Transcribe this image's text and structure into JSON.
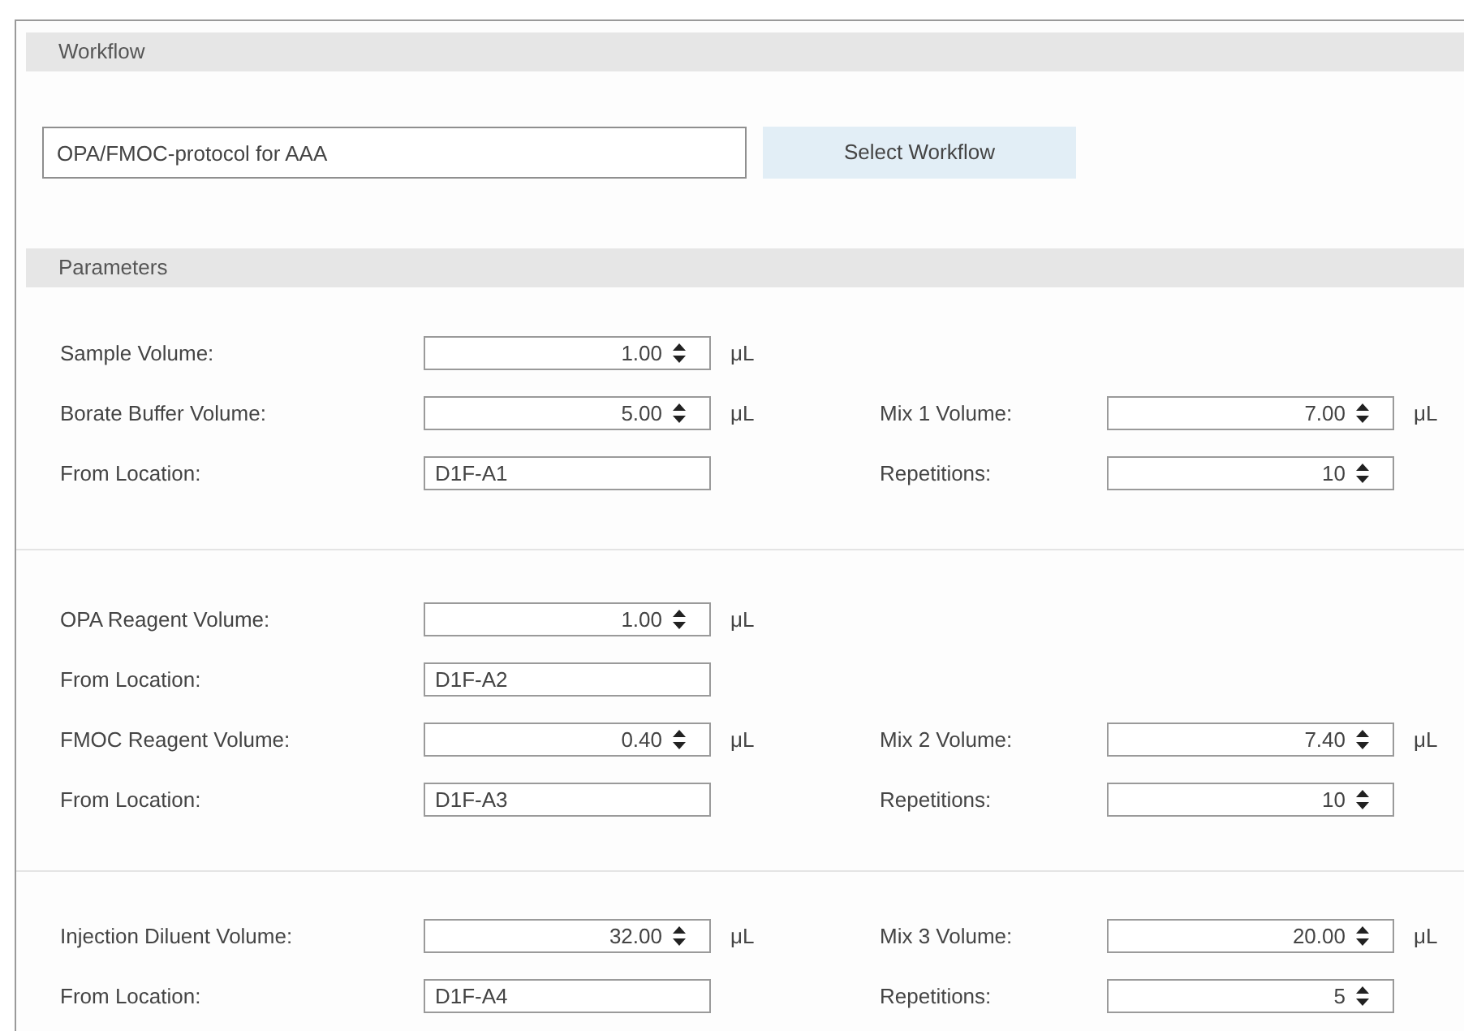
{
  "workflow": {
    "header": "Workflow",
    "field": {
      "value": "OPA/FMOC-protocol for AAA"
    },
    "button": "Select Workflow"
  },
  "parameters": {
    "header": "Parameters",
    "groups": [
      {
        "rows": [
          {
            "left": {
              "label": "Sample Volume:",
              "kind": "spin",
              "value": "1.00",
              "unit": "μL"
            }
          },
          {
            "left": {
              "label": "Borate Buffer Volume:",
              "kind": "spin",
              "value": "5.00",
              "unit": "μL"
            },
            "right": {
              "label": "Mix 1 Volume:",
              "kind": "spin",
              "value": "7.00",
              "unit": "μL"
            }
          },
          {
            "left": {
              "label": "From Location:",
              "kind": "text",
              "value": "D1F-A1"
            },
            "right": {
              "label": "Repetitions:",
              "kind": "spin",
              "value": "10"
            }
          }
        ]
      },
      {
        "rows": [
          {
            "left": {
              "label": "OPA Reagent Volume:",
              "kind": "spin",
              "value": "1.00",
              "unit": "μL"
            }
          },
          {
            "left": {
              "label": "From Location:",
              "kind": "text",
              "value": "D1F-A2"
            }
          },
          {
            "left": {
              "label": "FMOC Reagent Volume:",
              "kind": "spin",
              "value": "0.40",
              "unit": "μL"
            },
            "right": {
              "label": "Mix 2 Volume:",
              "kind": "spin",
              "value": "7.40",
              "unit": "μL"
            }
          },
          {
            "left": {
              "label": "From Location:",
              "kind": "text",
              "value": "D1F-A3"
            },
            "right": {
              "label": "Repetitions:",
              "kind": "spin",
              "value": "10"
            }
          }
        ]
      },
      {
        "rows": [
          {
            "left": {
              "label": "Injection Diluent Volume:",
              "kind": "spin",
              "value": "32.00",
              "unit": "μL"
            },
            "right": {
              "label": "Mix 3 Volume:",
              "kind": "spin",
              "value": "20.00",
              "unit": "μL"
            }
          },
          {
            "left": {
              "label": "From Location:",
              "kind": "text",
              "value": "D1F-A4"
            },
            "right": {
              "label": "Repetitions:",
              "kind": "spin",
              "value": "5"
            }
          }
        ]
      }
    ]
  }
}
